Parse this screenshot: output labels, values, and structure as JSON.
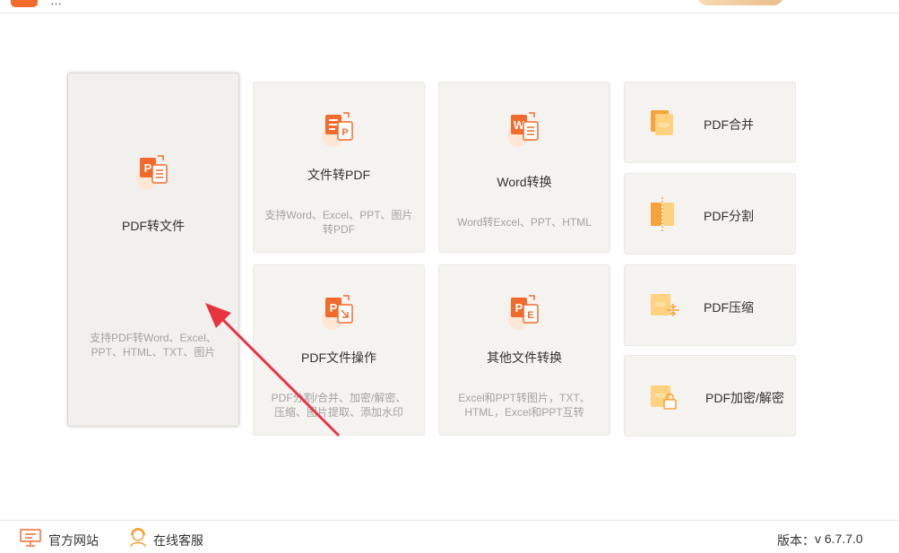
{
  "header": {
    "app_title": "…"
  },
  "cards": {
    "pdf_to_file": {
      "title": "PDF转文件",
      "desc_line1": "支持PDF转Word、Excel、",
      "desc_line2": "PPT、HTML、TXT、图片"
    },
    "file_to_pdf": {
      "title": "文件转PDF",
      "desc_line1": "支持Word、Excel、PPT、图片",
      "desc_line2": "转PDF"
    },
    "word_convert": {
      "title": "Word转换",
      "desc_line1": "Word转Excel、PPT、HTML"
    },
    "pdf_ops": {
      "title": "PDF文件操作",
      "desc_line1": "PDF分割/合并、加密/解密、",
      "desc_line2": "压缩、图片提取、添加水印"
    },
    "other_convert": {
      "title": "其他文件转换",
      "desc_line1": "Excel和PPT转图片，TXT、",
      "desc_line2": "HTML，Excel和PPT互转"
    },
    "pdf_merge": {
      "title": "PDF合并"
    },
    "pdf_split": {
      "title": "PDF分割"
    },
    "pdf_compress": {
      "title": "PDF压缩"
    },
    "pdf_encrypt": {
      "title": "PDF加密/解密"
    }
  },
  "icon_labels": {
    "pdf": "PDF",
    "p": "P",
    "w": "W",
    "e": "E"
  },
  "footer": {
    "website_label": "官方网站",
    "support_label": "在线客服",
    "version_label": "版本：",
    "version_value": "v 6.7.7.0"
  },
  "colors": {
    "accent": "#f36b2c",
    "icon_light": "#ffc66b",
    "arrow": "#e8343f"
  }
}
